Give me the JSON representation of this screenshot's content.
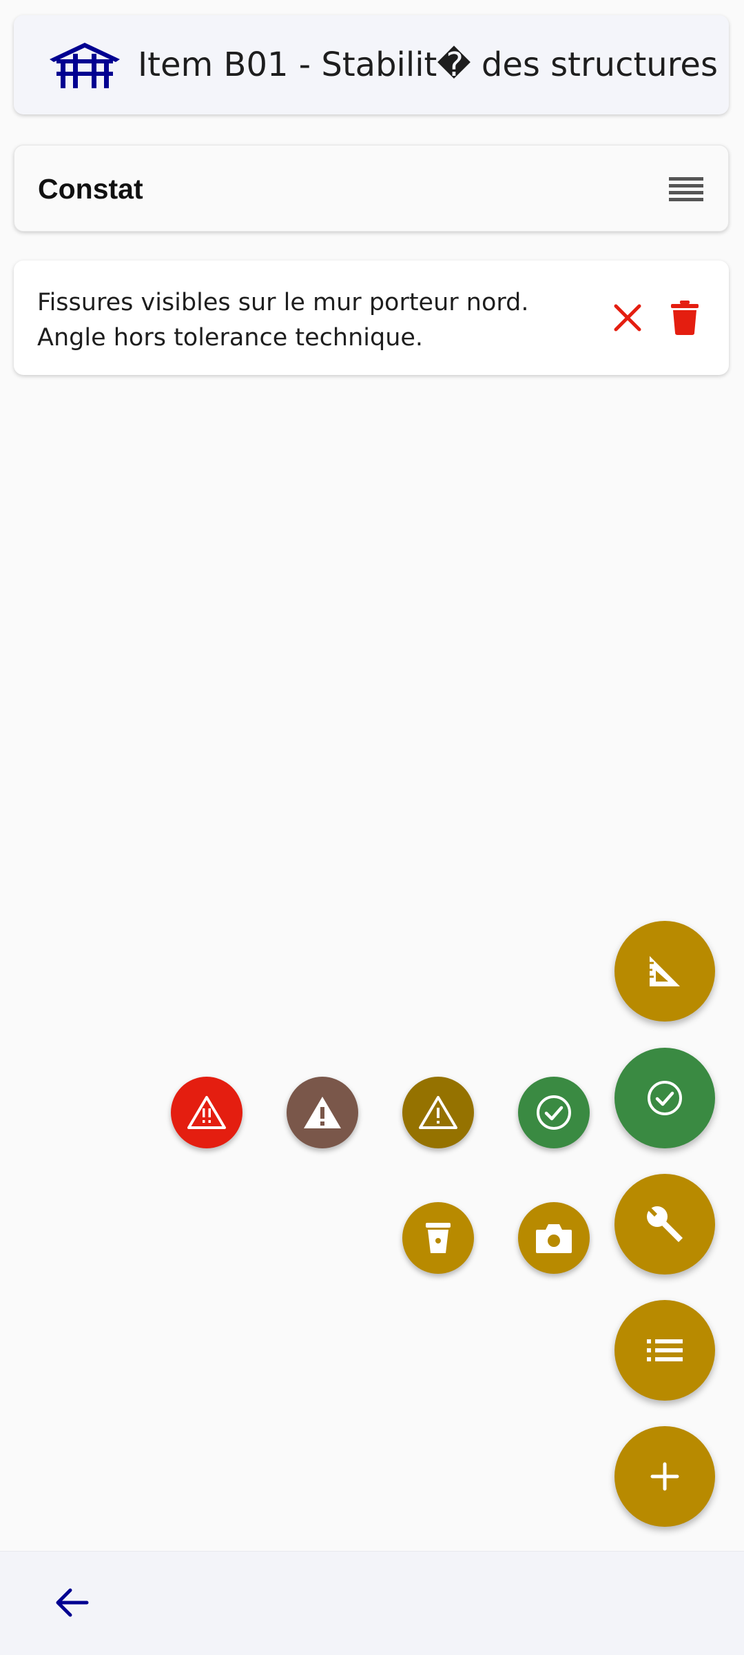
{
  "header": {
    "title": "Item B01 - Stabilit� des structures",
    "logo_icon": "building-icon",
    "brand_color": "#000091"
  },
  "section": {
    "label": "Constat",
    "menu_icon": "list-lines-icon"
  },
  "observation": {
    "line1": "Fissures visibles sur le mur porteur nord.",
    "line2": "Angle hors tolerance technique.",
    "close_icon": "close-icon",
    "delete_icon": "trash-icon",
    "danger_color": "#e41e10"
  },
  "fabs": [
    {
      "name": "measure-fab",
      "icon": "set-square-icon",
      "color": "#b88a00"
    },
    {
      "name": "conform-fab",
      "icon": "check-circle-icon",
      "color": "#3a8a42"
    },
    {
      "name": "tool-fab",
      "icon": "wrench-icon",
      "color": "#b88a00"
    },
    {
      "name": "list-fab",
      "icon": "list-icon",
      "color": "#b88a00"
    },
    {
      "name": "add-fab",
      "icon": "plus-icon",
      "color": "#b88a00"
    }
  ],
  "mini_actions": [
    {
      "name": "critical-warning-button",
      "icon": "warning-critical-icon",
      "color": "#e41e10"
    },
    {
      "name": "major-warning-button",
      "icon": "warning-filled-icon",
      "color": "#7a574a"
    },
    {
      "name": "minor-warning-button",
      "icon": "warning-outline-icon",
      "color": "#957200"
    },
    {
      "name": "ok-button",
      "icon": "check-circle-icon",
      "color": "#3a8a42"
    },
    {
      "name": "cup-button",
      "icon": "cup-icon",
      "color": "#b88a00"
    },
    {
      "name": "camera-button",
      "icon": "camera-icon",
      "color": "#b88a00"
    }
  ],
  "bottom_bar": {
    "back_icon": "arrow-left-icon"
  }
}
